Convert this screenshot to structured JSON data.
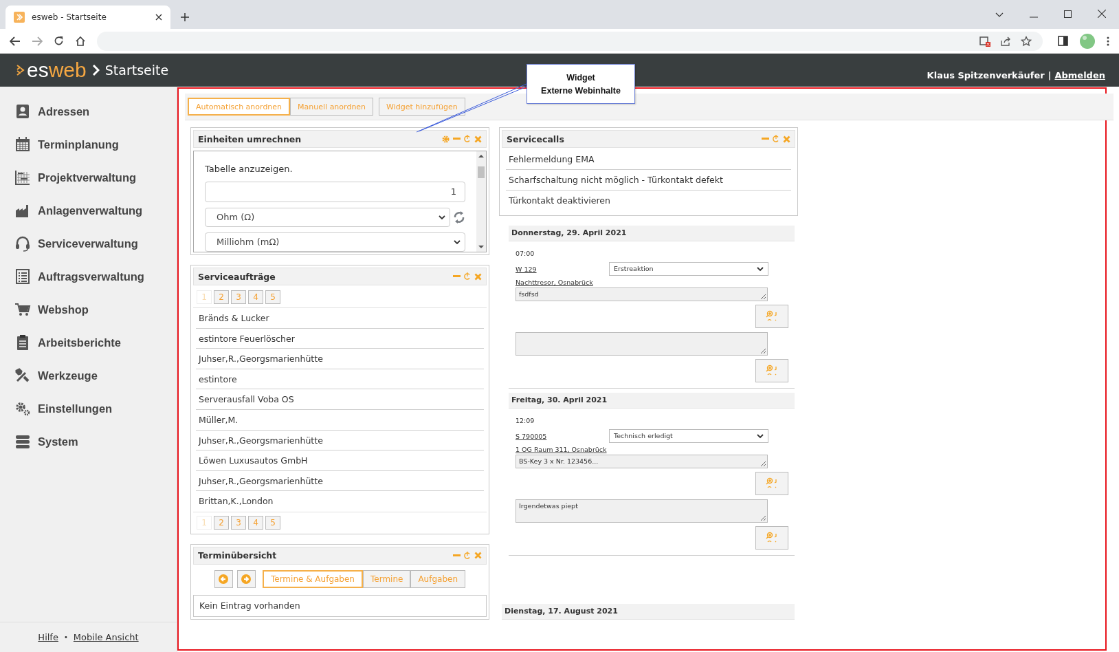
{
  "browser": {
    "tab_title": "esweb - Startseite"
  },
  "header": {
    "logo_prefix": "es",
    "logo_suffix": "web",
    "page": "Startseite",
    "user": "Klaus Spitzenverkäufer",
    "separator": "|",
    "logout": "Abmelden"
  },
  "sidebar": {
    "items": [
      {
        "label": "Adressen"
      },
      {
        "label": "Terminplanung"
      },
      {
        "label": "Projektverwaltung"
      },
      {
        "label": "Anlagenverwaltung"
      },
      {
        "label": "Serviceverwaltung"
      },
      {
        "label": "Auftragsverwaltung"
      },
      {
        "label": "Webshop"
      },
      {
        "label": "Arbeitsberichte"
      },
      {
        "label": "Werkzeuge"
      },
      {
        "label": "Einstellungen"
      },
      {
        "label": "System"
      }
    ],
    "footer": {
      "links": [
        "Hilfe",
        "Mobile Ansicht"
      ],
      "separator": "•"
    }
  },
  "toolbar": {
    "arrange": [
      {
        "label": "Automatisch anordnen",
        "selected": true
      },
      {
        "label": "Manuell anordnen",
        "selected": false
      }
    ],
    "add_widget": "Widget hinzufügen"
  },
  "callout": {
    "lines": [
      "Widget",
      "Externe Webinhalte"
    ]
  },
  "converter": {
    "title": "Einheiten umrechnen",
    "has_settings": true,
    "text_lines": [
      "Tabelle anzuzeigen."
    ],
    "value": "1",
    "from_unit": "Ohm (Ω)",
    "to_unit": "Milliohm (mΩ)"
  },
  "service_orders": {
    "title": "Serviceaufträge",
    "has_settings": false,
    "pages_top": [
      {
        "label": "1",
        "selected": true
      },
      {
        "label": "2",
        "selected": false
      },
      {
        "label": "3",
        "selected": false
      },
      {
        "label": "4",
        "selected": false
      },
      {
        "label": "5",
        "selected": false
      }
    ],
    "rows": [
      "Bränds & Lucker",
      "estintore Feuerlöscher",
      "Juhser,R.,Georgsmarienhütte",
      "estintore",
      "Serverausfall Voba OS",
      "Müller,M.",
      "Juhser,R.,Georgsmarienhütte",
      "Löwen Luxusautos GmbH",
      "Juhser,R.,Georgsmarienhütte",
      "Brittan,K.,London"
    ],
    "pages_bottom": [
      {
        "label": "1",
        "selected": true
      },
      {
        "label": "2",
        "selected": false
      },
      {
        "label": "3",
        "selected": false
      },
      {
        "label": "4",
        "selected": false
      },
      {
        "label": "5",
        "selected": false
      }
    ]
  },
  "appointments": {
    "title": "Terminübersicht",
    "has_settings": false,
    "filters": [
      {
        "label": "Termine & Aufgaben",
        "selected": true
      },
      {
        "label": "Termine",
        "selected": false
      },
      {
        "label": "Aufgaben",
        "selected": false
      }
    ],
    "empty": "Kein Eintrag vorhanden"
  },
  "servicecalls": {
    "title": "Servicecalls",
    "has_settings": false,
    "rows": [
      "Fehlermeldung EMA",
      "Scharfschaltung nicht möglich - Türkontakt defekt",
      "Türkontakt deaktivieren"
    ]
  },
  "days": [
    {
      "date": "Donnerstag, 29. April 2021",
      "entries": [
        {
          "time": "07:00",
          "number": "W 129",
          "status": "Erstreaktion",
          "location": "Nachttresor, Osnabrück",
          "note": "fsdfsd"
        }
      ]
    },
    {
      "date": "Freitag, 30. April 2021",
      "entries": [
        {
          "time": "12:09",
          "number": "S 790005",
          "status": "Technisch erledigt",
          "location": "1 OG Raum 311, Osnabrück",
          "note": "BS-Key 3 x Nr. 123456...",
          "comment": "Irgendetwas piept"
        }
      ]
    },
    {
      "date": "Dienstag, 17. August 2021"
    }
  ]
}
